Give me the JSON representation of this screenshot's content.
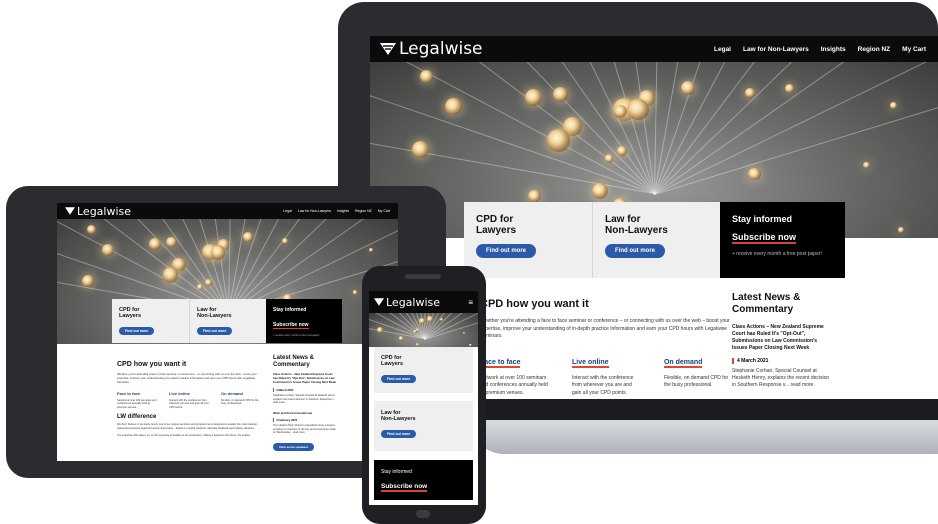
{
  "site": {
    "logo_text": "Legalwise",
    "nav": [
      "Legal",
      "Law for Non-Lawyers",
      "Insights",
      "Region NZ",
      "My Cart"
    ]
  },
  "cards": {
    "cpd_lawyers": {
      "title_l1": "CPD for",
      "title_l2": "Lawyers",
      "button": "Find out more"
    },
    "non_lawyers": {
      "title_l1": "Law for",
      "title_l2": "Non-Lawyers",
      "button": "Find out more"
    },
    "stay_informed": {
      "title": "Stay informed",
      "link": "Subscribe now",
      "note": "+ receive every month a free post paper!"
    }
  },
  "main": {
    "heading": "CPD how you want it",
    "intro": "Whether you're attending a face to face seminar or conference – or connecting with us over the web – boost your expertise, improve your understanding of in-depth practice information and earn your CPD hours with Legalwise Seminars.",
    "features": [
      {
        "title": "Face to face",
        "text": "Network at over 100 seminars and conferences annually held at premium venues."
      },
      {
        "title": "Live online",
        "text": "Interact with the conference from wherever you are and gain all your CPD points."
      },
      {
        "title": "On demand",
        "text": "Flexible, on demand CPD for the busy professional."
      }
    ],
    "lw_heading": "LW difference",
    "lw_text": "We don't believe in seminars. Every one of our unique seminars and programmes is designed to sustain the most relevant, topical and pertinent legal and accounting issues – based on careful research, attendee feedback and industry advisors.",
    "lw_text2": "Our expertise will make it so, on the expertise of leaders in the profession, making it appeal to the future, the market.",
    "lw_button": "View some speakers"
  },
  "news": {
    "heading": "Latest News & Commentary",
    "article_title": "Class Actions – New Zealand Supreme Court has Ruled It's \"Opt-Out\", Submissions on Law Commission's Issues Paper Closing Next Week",
    "date": "4 March 2021",
    "summary": "Stephanie Corban, Special Counsel at Hesketh Henry, explains the recent decision in Southern Response v... read more",
    "tablet_article2_title": "Work and Environmental Law",
    "tablet_article2_date": "4 February 2021",
    "tablet_article2_text": "Tom Hudson Muir, Director at Hesketh Henry Lawyers, provides an overview of the key announcements made on Wednesday... read more"
  },
  "colors": {
    "brand_dark": "#0b0b0b",
    "button_blue": "#2a5aa8",
    "accent_red": "#d9413a"
  }
}
